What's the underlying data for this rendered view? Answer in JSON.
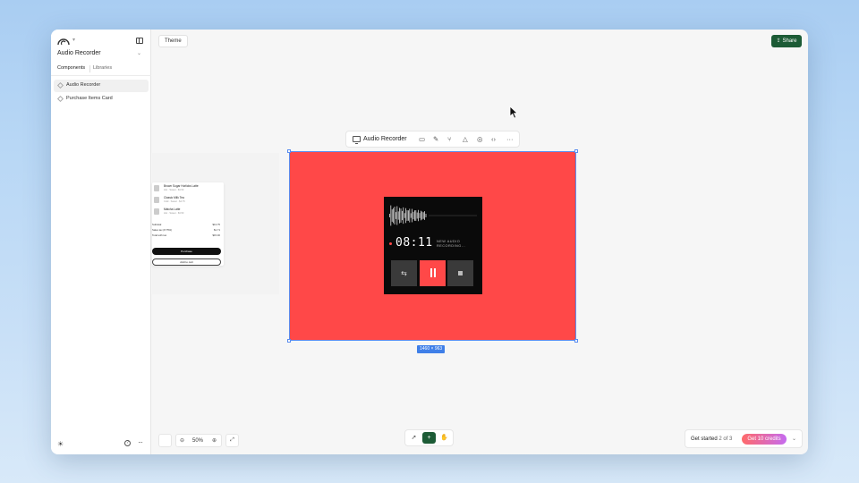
{
  "project": {
    "name": "Audio Recorder"
  },
  "sidebar": {
    "tabs": [
      "Components",
      "Libraries"
    ],
    "items": [
      {
        "label": "Audio Recorder",
        "active": true
      },
      {
        "label": "Purchase Items Card",
        "active": false
      }
    ]
  },
  "header": {
    "theme_label": "Theme",
    "share_label": "Share"
  },
  "frame_toolbar": {
    "title": "Audio Recorder"
  },
  "canvas": {
    "dimension_label": "1460 × 963",
    "artboard_color": "#ff4848"
  },
  "recorder": {
    "time": "08:11",
    "label": "NEW AUDIO RECORDING..."
  },
  "ghost_card": {
    "items": [
      {
        "name": "Brown Sugar Horlicks Latte",
        "sub": "Hot · Sweet · $4.50"
      },
      {
        "name": "Classic Milk Tea",
        "sub": "Cold · Sweet · $4.75"
      },
      {
        "name": "Matcha Latte",
        "sub": "Hot · Sweet · $4.50"
      }
    ],
    "totals": [
      {
        "label": "Subtotal",
        "value": "$13.75"
      },
      {
        "label": "Sales tax (8.75%)",
        "value": "$1.71"
      },
      {
        "label": "Total with tax",
        "value": "$15.46"
      }
    ],
    "purchase_label": "Purchase",
    "add_label": "Add to cart"
  },
  "zoom": {
    "level": "50%"
  },
  "get_started": {
    "label": "Get started",
    "progress": "2 of 3",
    "credits_label": "Get 10 credits"
  },
  "colors": {
    "share_bg": "#1c5b36",
    "accent_blue": "#3f7fe8"
  }
}
